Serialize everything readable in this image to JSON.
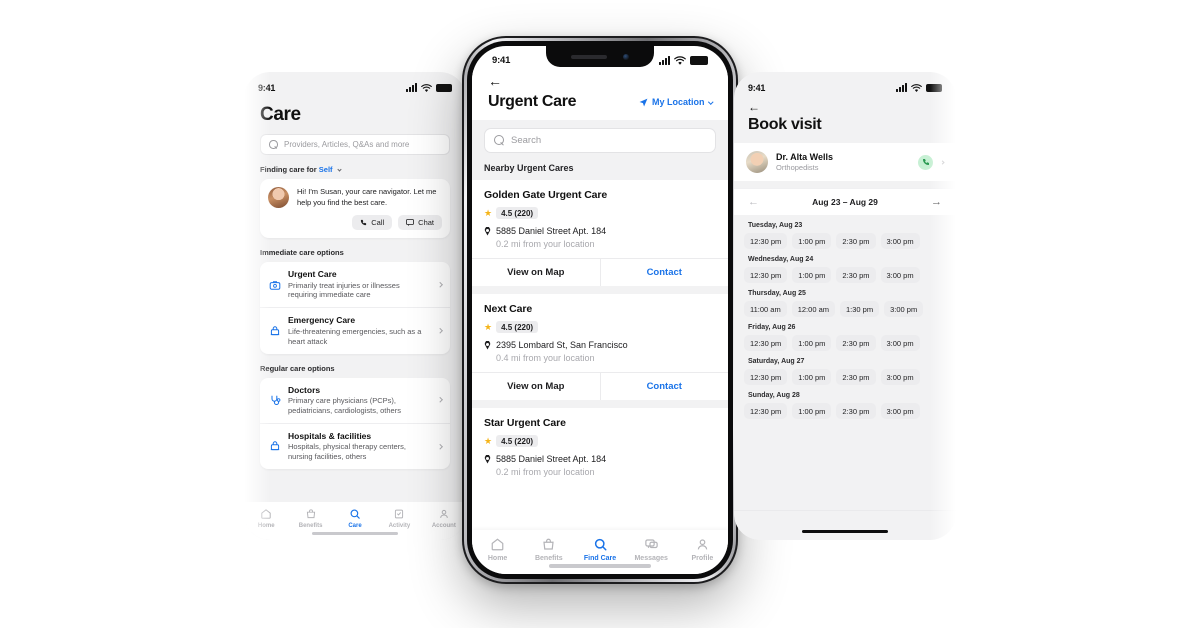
{
  "left_phone": {
    "status_bar": {
      "time": "9:41"
    },
    "page_title": "Care",
    "search": {
      "placeholder": "Providers, Articles, Q&As and more",
      "value": ""
    },
    "finding_care": {
      "prefix": "Finding care for",
      "selected": "Self"
    },
    "navigator": {
      "message": "Hi! I'm Susan, your care navigator. Let me help you find the best care.",
      "call_label": "Call",
      "chat_label": "Chat"
    },
    "sections": [
      {
        "heading": "Immediate care options",
        "items": [
          {
            "title": "Urgent Care",
            "desc": "Primarily treat injuries or illnesses requiring immediate care",
            "icon": "urgent-care-icon"
          },
          {
            "title": "Emergency Care",
            "desc": "Life-threatening emergencies, such as a heart attack",
            "icon": "emergency-care-icon"
          }
        ]
      },
      {
        "heading": "Regular care options",
        "items": [
          {
            "title": "Doctors",
            "desc": "Primary care physicians (PCPs), pediatricians, cardiologists, others",
            "icon": "stethoscope-icon"
          },
          {
            "title": "Hospitals & facilities",
            "desc": "Hospitals, physical therapy centers, nursing facilities, others",
            "icon": "hospital-icon"
          }
        ]
      }
    ],
    "tabs": [
      {
        "label": "Home",
        "icon": "home-icon",
        "active": false
      },
      {
        "label": "Benefits",
        "icon": "benefits-icon",
        "active": false
      },
      {
        "label": "Care",
        "icon": "search-icon",
        "active": true
      },
      {
        "label": "Activity",
        "icon": "activity-icon",
        "active": false
      },
      {
        "label": "Account",
        "icon": "person-icon",
        "active": false
      }
    ]
  },
  "center_phone": {
    "status_bar": {
      "time": "9:41"
    },
    "back_label": "←",
    "page_title": "Urgent Care",
    "location": {
      "label": "My Location",
      "icon": "location-arrow-icon"
    },
    "search": {
      "placeholder": "Search",
      "value": ""
    },
    "list_heading": "Nearby Urgent Cares",
    "actions": {
      "map_label": "View on Map",
      "contact_label": "Contact"
    },
    "places": [
      {
        "name": "Golden Gate Urgent Care",
        "rating": "4.5 (220)",
        "address": "5885 Daniel Street Apt. 184",
        "distance": "0.2 mi from your location"
      },
      {
        "name": "Next Care",
        "rating": "4.5 (220)",
        "address": "2395 Lombard St, San Francisco",
        "distance": "0.4 mi from your location"
      },
      {
        "name": "Star Urgent Care",
        "rating": "4.5 (220)",
        "address": "5885 Daniel Street Apt. 184",
        "distance": "0.2 mi from your location"
      }
    ],
    "tabs": [
      {
        "label": "Home",
        "icon": "home-icon",
        "active": false
      },
      {
        "label": "Benefits",
        "icon": "benefits-icon",
        "active": false
      },
      {
        "label": "Find Care",
        "icon": "search-icon",
        "active": true
      },
      {
        "label": "Messages",
        "icon": "messages-icon",
        "active": false
      },
      {
        "label": "Profile",
        "icon": "person-icon",
        "active": false
      }
    ]
  },
  "right_phone": {
    "status_bar": {
      "time": "9:41"
    },
    "back_label": "←",
    "page_title": "Book visit",
    "doctor": {
      "name": "Dr. Alta Wells",
      "specialty": "Orthopedists",
      "call_icon": "phone-icon"
    },
    "week": {
      "range": "Aug 23 – Aug 29",
      "prev_icon": "arrow-left-icon",
      "next_icon": "arrow-right-icon"
    },
    "days": [
      {
        "label": "Tuesday, Aug 23",
        "slots": [
          "12:30 pm",
          "1:00 pm",
          "2:30 pm",
          "3:00 pm"
        ]
      },
      {
        "label": "Wednesday, Aug 24",
        "slots": [
          "12:30 pm",
          "1:00 pm",
          "2:30 pm",
          "3:00 pm"
        ]
      },
      {
        "label": "Thursday, Aug 25",
        "slots": [
          "11:00 am",
          "12:00 am",
          "1:30 pm",
          "3:00 pm"
        ]
      },
      {
        "label": "Friday, Aug 26",
        "slots": [
          "12:30 pm",
          "1:00 pm",
          "2:30 pm",
          "3:00 pm"
        ]
      },
      {
        "label": "Saturday, Aug 27",
        "slots": [
          "12:30 pm",
          "1:00 pm",
          "2:30 pm",
          "3:00 pm"
        ]
      },
      {
        "label": "Sunday, Aug 28",
        "slots": [
          "12:30 pm",
          "1:00 pm",
          "2:30 pm",
          "3:00 pm"
        ]
      }
    ]
  },
  "colors": {
    "accent_blue": "#1a73e8",
    "star_yellow": "#f5b418",
    "call_green": "#2b9a52",
    "screen_bg": "#f2f2f3",
    "page_bg": "#ffffff"
  }
}
